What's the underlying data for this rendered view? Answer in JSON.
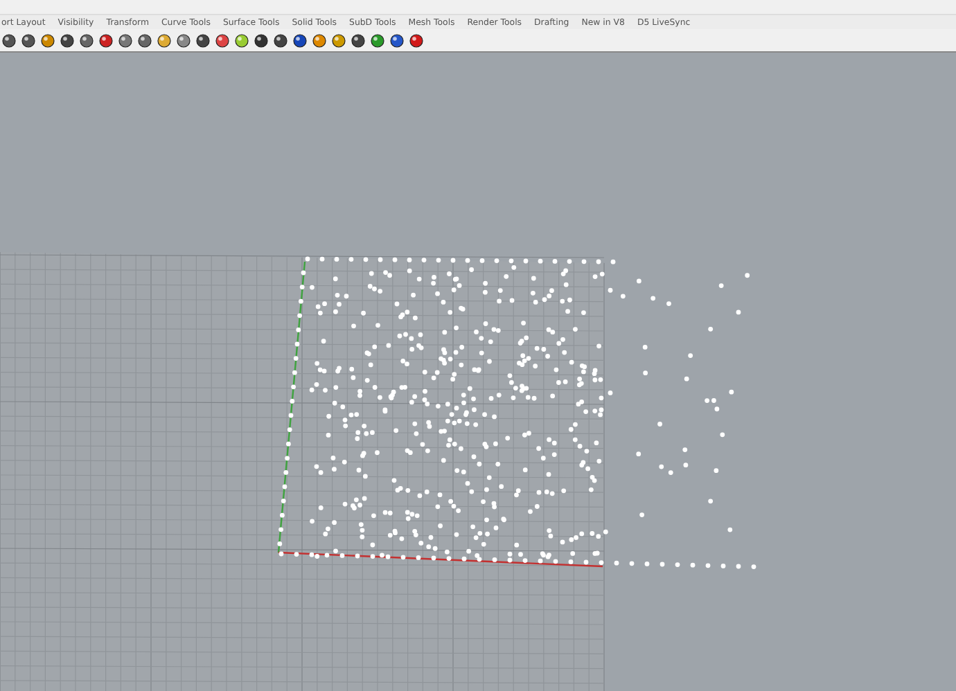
{
  "toolbar_tabs": [
    {
      "label": "ort Layout"
    },
    {
      "label": "Visibility"
    },
    {
      "label": "Transform"
    },
    {
      "label": "Curve Tools"
    },
    {
      "label": "Surface Tools"
    },
    {
      "label": "Solid Tools"
    },
    {
      "label": "SubD Tools"
    },
    {
      "label": "Mesh Tools"
    },
    {
      "label": "Render Tools"
    },
    {
      "label": "Drafting"
    },
    {
      "label": "New in V8"
    },
    {
      "label": "D5 LiveSync"
    }
  ]
}
